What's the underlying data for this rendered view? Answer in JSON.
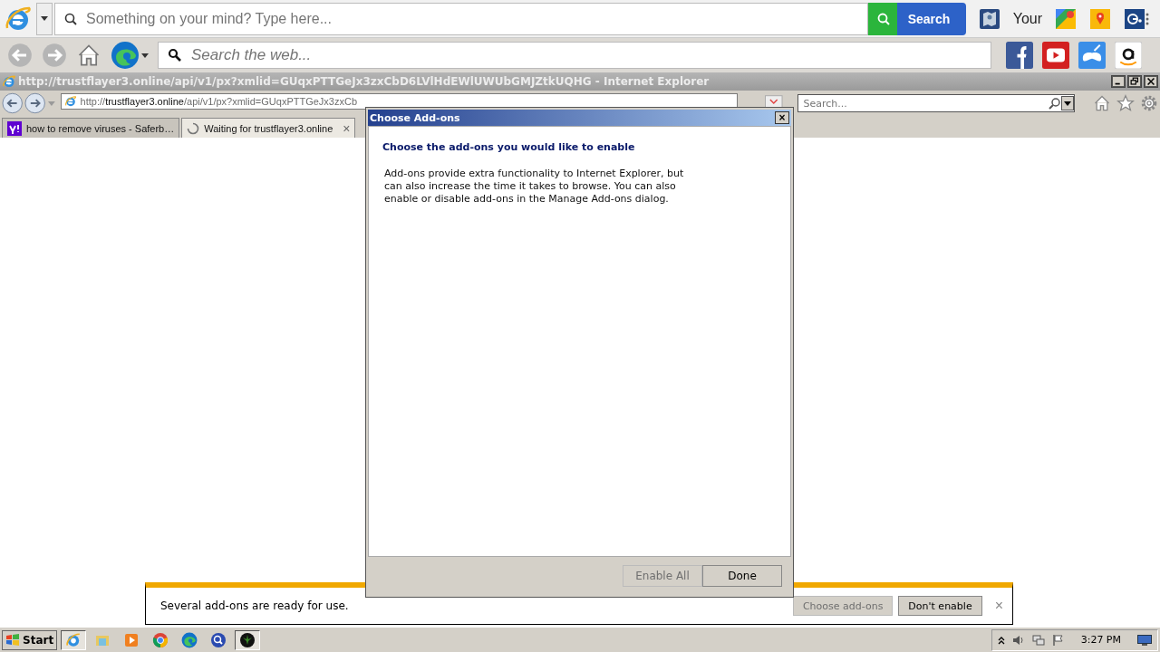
{
  "toolbar_top": {
    "search": {
      "placeholder": "Something on your mind? Type here..."
    },
    "search_button": "Search",
    "link_text": "Your"
  },
  "toolbar_second": {
    "search": {
      "placeholder": "Search the web..."
    }
  },
  "window": {
    "title": "http://trustflayer3.online/api/v1/px?xmlid=GUqxPTTGeJx3zxCbD6LVlHdEWlUWUbGMJZtkUQHG - Internet Explorer"
  },
  "address_bar": {
    "scheme": "http://",
    "host": "trustflayer3.online",
    "path": "/api/v1/px?xmlid=GUqxPTTGeJx3zxCb"
  },
  "search_box": {
    "placeholder": "Search..."
  },
  "tabs": [
    {
      "label": "how to remove viruses - Saferb…",
      "kind": "yahoo",
      "selected": false
    },
    {
      "label": "Waiting for trustflayer3.online",
      "kind": "loading",
      "selected": true,
      "close": "×"
    }
  ],
  "dialog": {
    "title": "Choose Add-ons",
    "close": "×",
    "heading": "Choose the add-ons you would like to enable",
    "text": "Add-ons provide extra functionality to Internet Explorer, but can also increase the time it takes to browse. You can also enable or disable add-ons in the Manage Add-ons dialog.",
    "buttons": [
      {
        "label": "Enable All",
        "disabled": true
      },
      {
        "label": "Done",
        "disabled": false
      }
    ]
  },
  "notification": {
    "text": "Several add-ons are ready for use.",
    "buttons": [
      {
        "label": "Choose add-ons",
        "disabled": true
      },
      {
        "label": "Don't enable",
        "disabled": false
      }
    ],
    "close": "×"
  },
  "taskbar": {
    "start": "Start",
    "apps": [
      {
        "kind": "ie",
        "selected": true
      },
      {
        "kind": "folder",
        "selected": false
      },
      {
        "kind": "media",
        "selected": false
      },
      {
        "kind": "chrome",
        "selected": false
      },
      {
        "kind": "edge",
        "selected": false
      },
      {
        "kind": "search",
        "selected": false
      },
      {
        "kind": "leaf",
        "selected": true
      }
    ],
    "clock": "3:27 PM"
  }
}
